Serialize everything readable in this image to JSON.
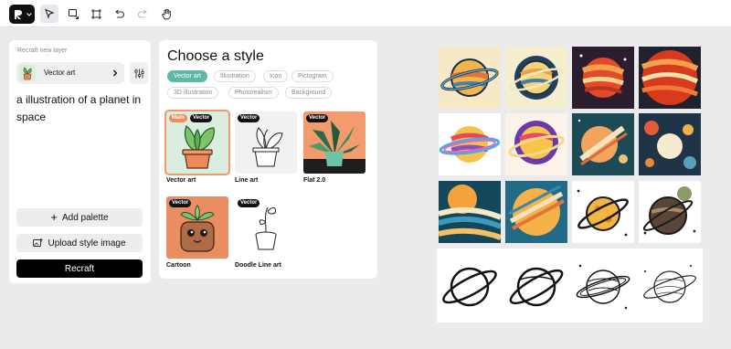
{
  "toolbar": {
    "tools": [
      {
        "name": "logo-menu-button"
      },
      {
        "name": "select-tool"
      },
      {
        "name": "lasso-tool"
      },
      {
        "name": "frame-tool"
      },
      {
        "name": "undo-button"
      },
      {
        "name": "redo-button"
      },
      {
        "name": "hand-tool"
      }
    ]
  },
  "left_panel": {
    "caption": "Recraft new layer",
    "model_label": "Vector art",
    "prompt": "a illustration of a planet in space",
    "add_palette_label": "Add palette",
    "upload_style_label": "Upload style image",
    "generate_label": "Recraft"
  },
  "style_panel": {
    "title": "Choose a style",
    "chips": [
      "Vector art",
      "Illustration",
      "Icon",
      "Pictogram",
      "3D illustration",
      "Photorealism",
      "Background"
    ],
    "active_chip": "Vector art",
    "cards": [
      {
        "label": "Vector art",
        "badges": [
          "Main",
          "Vector"
        ],
        "selected": true
      },
      {
        "label": "Line art",
        "badges": [
          "Vector"
        ],
        "selected": false
      },
      {
        "label": "Flat 2.0",
        "badges": [
          "Vector"
        ],
        "selected": false
      },
      {
        "label": "Cartoon",
        "badges": [
          "Vector"
        ],
        "selected": false
      },
      {
        "label": "Doodle Line art",
        "badges": [
          "Vector"
        ],
        "selected": false
      }
    ]
  },
  "colors": {
    "accent_teal": "#5fb7a5",
    "selected_outline": "#ee9a6d",
    "badge_main": "#ee8c5c",
    "primary_button": "#000000"
  }
}
